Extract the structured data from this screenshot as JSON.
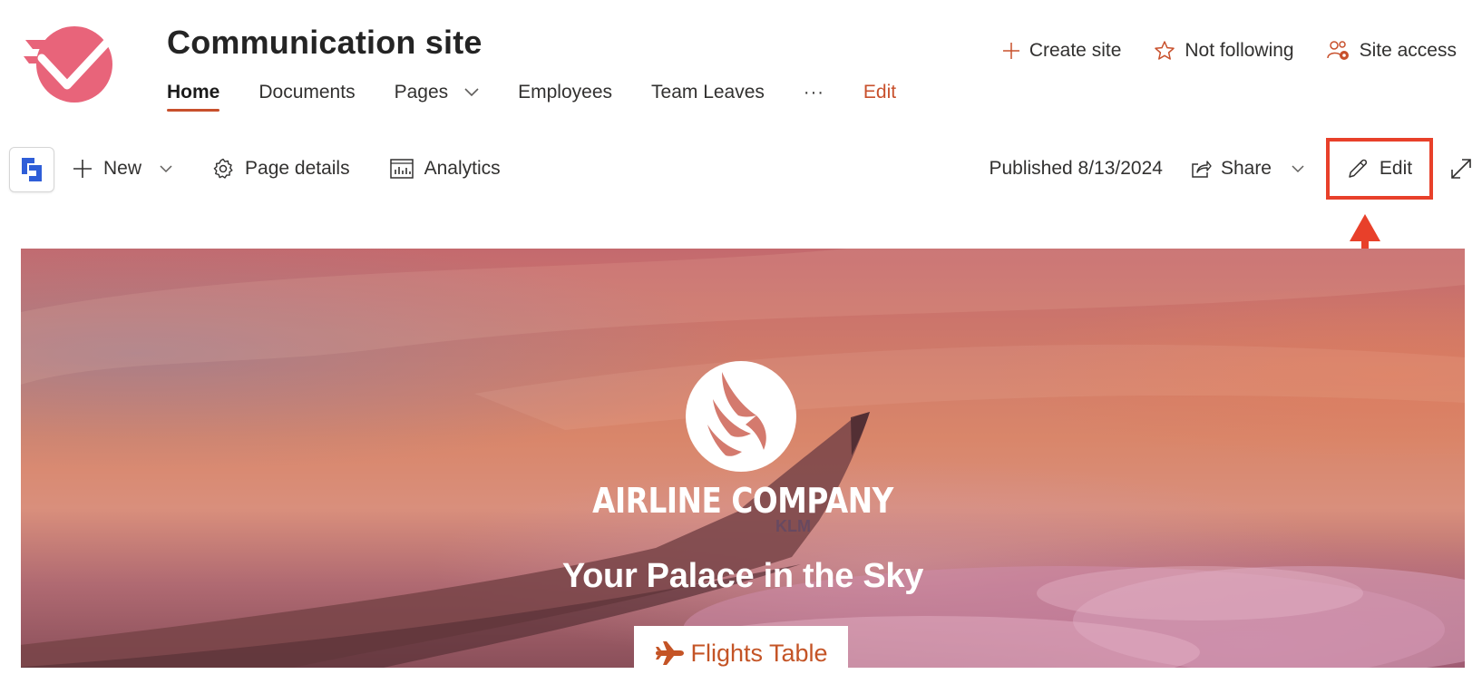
{
  "header": {
    "site_title": "Communication site",
    "nav": [
      {
        "label": "Home",
        "active": true
      },
      {
        "label": "Documents"
      },
      {
        "label": "Pages",
        "has_dropdown": true
      },
      {
        "label": "Employees"
      },
      {
        "label": "Team Leaves"
      }
    ],
    "more_label": "···",
    "edit_link_label": "Edit",
    "actions": {
      "create_site": "Create site",
      "not_following": "Not following",
      "site_access": "Site access"
    }
  },
  "command_bar": {
    "new_label": "New",
    "page_details_label": "Page details",
    "analytics_label": "Analytics",
    "published_text": "Published 8/13/2024",
    "share_label": "Share",
    "edit_label": "Edit"
  },
  "hero": {
    "company_name": "AIRLINE COMPANY",
    "tagline": "Your Palace in the Sky",
    "button_label": "Flights Table",
    "wing_text": "KLM"
  },
  "colors": {
    "accent": "#c8502c",
    "annotation": "#e8402a",
    "logo_pink": "#e8647a",
    "app_tile_blue": "#2f5ed8"
  }
}
